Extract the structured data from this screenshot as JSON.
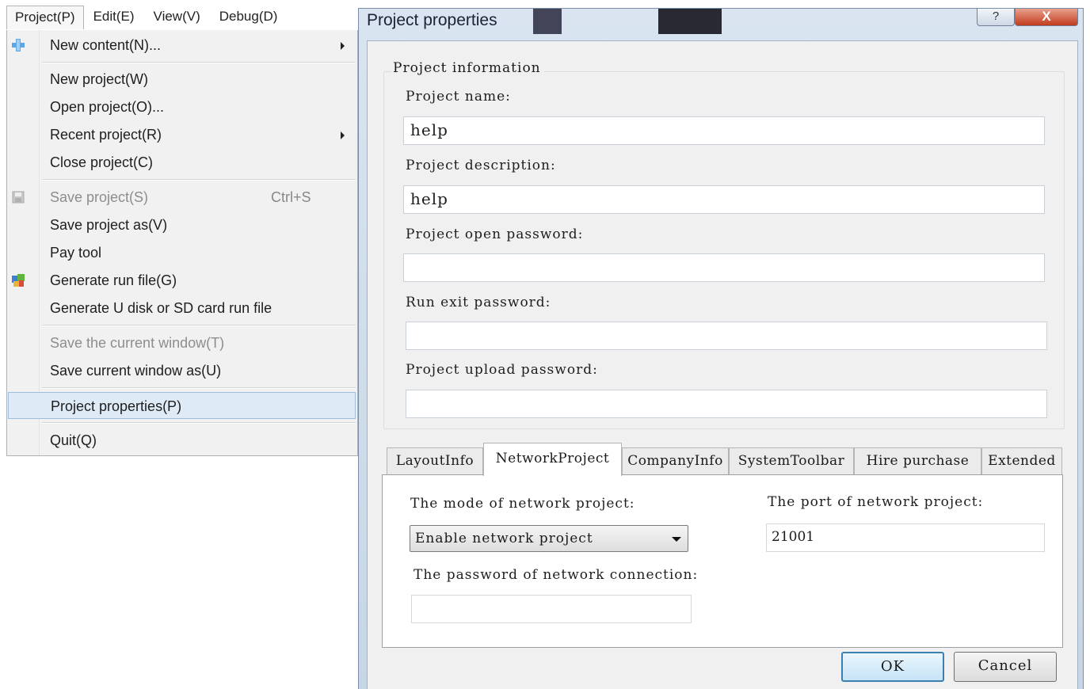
{
  "menubar": {
    "items": [
      "Project(P)",
      "Edit(E)",
      "View(V)",
      "Debug(D)"
    ]
  },
  "project_menu": {
    "new_content": "New content(N)...",
    "new_project": "New project(W)",
    "open_project": "Open project(O)...",
    "recent_project": "Recent project(R)",
    "close_project": "Close project(C)",
    "save_project": "Save project(S)",
    "save_project_shortcut": "Ctrl+S",
    "save_project_as": "Save project as(V)",
    "pay_tool": "Pay tool",
    "generate_run_file": "Generate run file(G)",
    "generate_udisk": "Generate U disk or SD card run file",
    "save_current_window": "Save the current window(T)",
    "save_current_window_as": "Save current window as(U)",
    "project_properties": "Project properties(P)",
    "quit": "Quit(Q)"
  },
  "dialog": {
    "title": "Project properties",
    "help_glyph": "?",
    "close_glyph": "X",
    "group_title": "Project information",
    "project_name_label": "Project name:",
    "project_name_value": "help",
    "project_description_label": "Project description:",
    "project_description_value": "help",
    "open_password_label": "Project open password:",
    "open_password_value": "",
    "exit_password_label": "Run exit password:",
    "exit_password_value": "",
    "upload_password_label": "Project upload password:",
    "upload_password_value": "",
    "tabs": [
      "LayoutInfo",
      "NetworkProject",
      "CompanyInfo",
      "SystemToolbar",
      "Hire purchase",
      "Extended"
    ],
    "network": {
      "mode_label": "The mode of network project:",
      "mode_value": "Enable network project",
      "port_label": "The port of network project:",
      "port_value": "21001",
      "password_label": "The password of network connection:",
      "password_value": ""
    },
    "ok_label": "OK",
    "cancel_label": "Cancel"
  }
}
